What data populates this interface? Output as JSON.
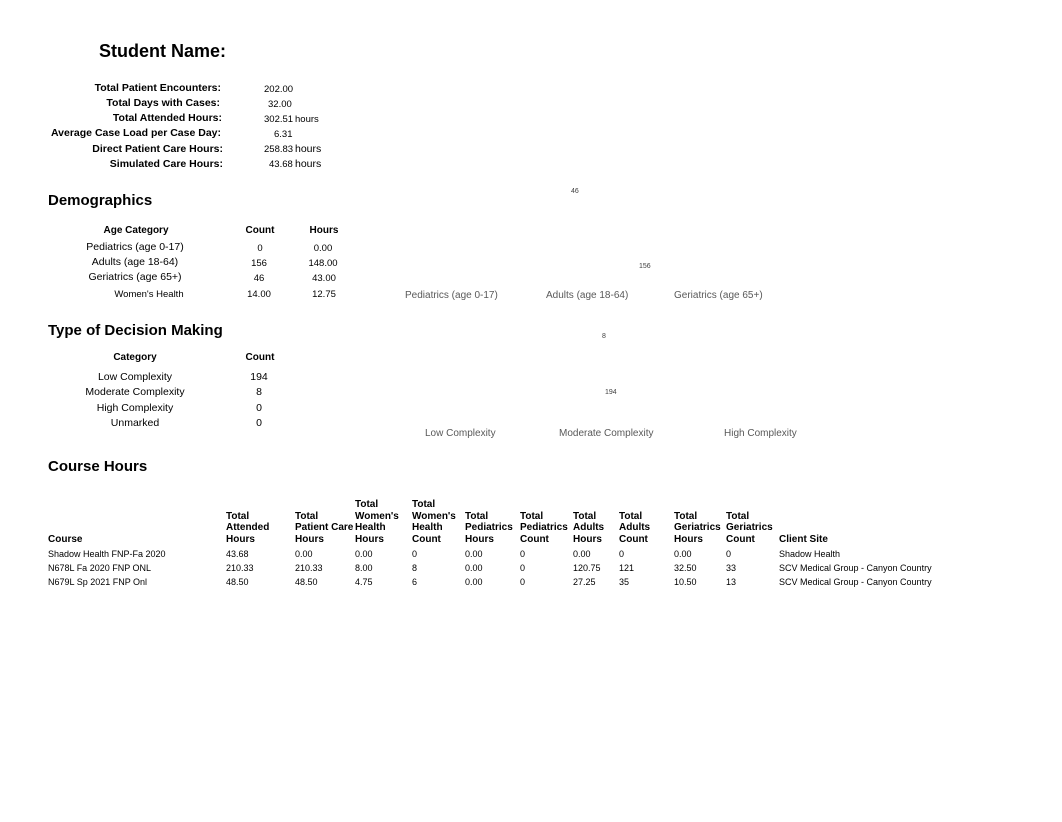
{
  "header": {
    "title": "Student Name:"
  },
  "summary": [
    {
      "label": "Total Patient Encounters:",
      "value": "202.00",
      "unit": ""
    },
    {
      "label": "Total Days with Cases:",
      "value": "32.00",
      "unit": ""
    },
    {
      "label": "Total Attended Hours:",
      "value": "302.51",
      "unit": "hours"
    },
    {
      "label": "Average Case Load per Case Day:",
      "value": "6.31",
      "unit": ""
    },
    {
      "label": "Direct Patient Care Hours:",
      "value": "258.83",
      "unit": "hours"
    },
    {
      "label": "Simulated Care Hours:",
      "value": "43.68",
      "unit": "hours"
    }
  ],
  "demographics": {
    "title": "Demographics",
    "headers": [
      "Age Category",
      "Count",
      "Hours"
    ],
    "rows": [
      [
        "Pediatrics (age 0-17)",
        "0",
        "0.00"
      ],
      [
        "Adults (age 18-64)",
        "156",
        "148.00"
      ],
      [
        "Geriatrics (age 65+)",
        "46",
        "43.00"
      ],
      [
        "Women's Health",
        "14.00",
        "12.75"
      ]
    ]
  },
  "decision": {
    "title": "Type of Decision Making",
    "headers": [
      "Category",
      "Count"
    ],
    "rows": [
      [
        "Low Complexity",
        "194"
      ],
      [
        "Moderate Complexity",
        "8"
      ],
      [
        "High Complexity",
        "0"
      ],
      [
        "Unmarked",
        "0"
      ]
    ]
  },
  "chart_data": [
    {
      "type": "pie",
      "title": "",
      "categories": [
        "Pediatrics (age 0-17)",
        "Adults (age 18-64)",
        "Geriatrics (age 65+)"
      ],
      "values": [
        0,
        156,
        46
      ],
      "data_labels": [
        "46",
        "156"
      ],
      "legend": "bottom"
    },
    {
      "type": "pie",
      "title": "",
      "categories": [
        "Low Complexity",
        "Moderate Complexity",
        "High Complexity"
      ],
      "values": [
        194,
        8,
        0
      ],
      "data_labels": [
        "8",
        "194"
      ],
      "legend": "bottom"
    }
  ],
  "course_hours": {
    "title": "Course Hours",
    "headers": [
      [
        "Course"
      ],
      [
        "Total",
        "Attended",
        "Hours"
      ],
      [
        "Total",
        "Patient Care",
        "Hours"
      ],
      [
        "Total",
        "Women's",
        "Health",
        "Hours"
      ],
      [
        "Total",
        "Women's",
        "Health",
        "Count"
      ],
      [
        "Total",
        "Pediatrics",
        "Hours"
      ],
      [
        "Total",
        "Pediatrics",
        "Count"
      ],
      [
        "Total",
        "Adults",
        "Hours"
      ],
      [
        "Total",
        "Adults",
        "Count"
      ],
      [
        "Total",
        "Geriatrics",
        "Hours"
      ],
      [
        "Total",
        "Geriatrics",
        "Count"
      ],
      [
        "Client Site"
      ]
    ],
    "rows": [
      [
        "Shadow Health FNP-Fa 2020",
        "43.68",
        "0.00",
        "0.00",
        "0",
        "0.00",
        "0",
        "0.00",
        "0",
        "0.00",
        "0",
        "Shadow Health"
      ],
      [
        "N678L Fa 2020 FNP ONL",
        "210.33",
        "210.33",
        "8.00",
        "8",
        "0.00",
        "0",
        "120.75",
        "121",
        "32.50",
        "33",
        "SCV Medical Group - Canyon Country"
      ],
      [
        "N679L Sp 2021 FNP Onl",
        "48.50",
        "48.50",
        "4.75",
        "6",
        "0.00",
        "0",
        "27.25",
        "35",
        "10.50",
        "13",
        "SCV Medical Group - Canyon Country"
      ]
    ]
  }
}
